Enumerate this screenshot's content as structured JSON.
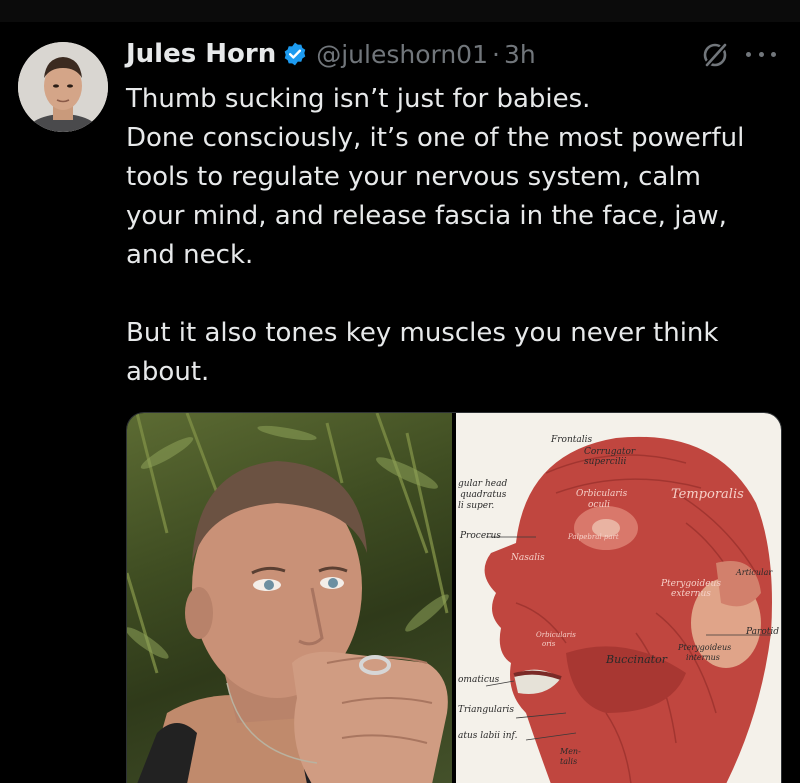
{
  "author": {
    "name": "Jules Horn",
    "handle": "@juleshorn01",
    "separator": "·",
    "time": "3h",
    "verified": true
  },
  "icons": {
    "verified": "verified-badge-icon",
    "grok": "grok-icon",
    "more": "more-options-icon"
  },
  "colors": {
    "background": "#000000",
    "text": "#e7e9ea",
    "muted": "#71767b",
    "verified_blue": "#1d9bf0"
  },
  "tweet": {
    "paragraph1": [
      "Thumb sucking isn’t just for babies.",
      "Done consciously, it’s one of the most powerful",
      "tools to regulate your nervous system, calm",
      "your mind, and release fascia in the face, jaw,",
      "and neck."
    ],
    "paragraph2": [
      "But it also tones key muscles you never think",
      "about."
    ]
  },
  "media": {
    "anatomy_labels": {
      "frontalis": "Frontalis",
      "corrugator": "Corrugator",
      "supercilii": "supercilii",
      "gular_head": "gular head",
      "quadratus": "quadratus",
      "li_super": "li super.",
      "orbicularis": "Orbicularis",
      "oculi": "oculi",
      "temporalis": "Temporalis",
      "procerus": "Procerus",
      "nasalis": "Nasalis",
      "palpebral": "Palpebral part",
      "pterygoideus": "Pterygoideus",
      "externus": "externus",
      "articular": "Articular",
      "parotid": "Parotid",
      "buccinator": "Buccinator",
      "pterygoideus_int": "Pterygoideus",
      "internus": "internus",
      "orbicularis_oris": "Orbicularis",
      "oris": "oris",
      "zygomaticus": "omaticus",
      "triangularis": "Triangularis",
      "labii_inf": "atus labii inf.",
      "mentalis": "Men-",
      "mentalis2": "talis"
    }
  }
}
